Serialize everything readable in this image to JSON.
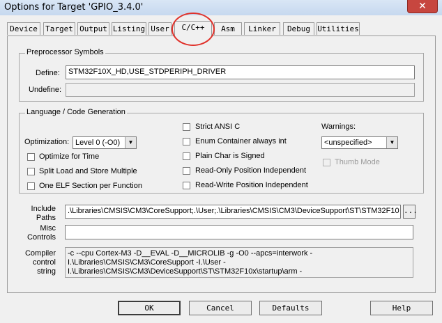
{
  "window": {
    "title": "Options for Target 'GPIO_3.4.0'",
    "close_label": "✕"
  },
  "tabs": [
    {
      "label": "Device"
    },
    {
      "label": "Target"
    },
    {
      "label": "Output"
    },
    {
      "label": "Listing"
    },
    {
      "label": "User"
    },
    {
      "label": "C/C++"
    },
    {
      "label": "Asm"
    },
    {
      "label": "Linker"
    },
    {
      "label": "Debug"
    },
    {
      "label": "Utilities"
    }
  ],
  "preprocessor": {
    "title": "Preprocessor Symbols",
    "define_label": "Define:",
    "define_value": "STM32F10X_HD,USE_STDPERIPH_DRIVER",
    "undefine_label": "Undefine:",
    "undefine_value": ""
  },
  "language": {
    "title": "Language / Code Generation",
    "optimization_label": "Optimization:",
    "optimization_value": "Level 0 (-O0)",
    "left_checks": [
      {
        "label": "Optimize for Time",
        "checked": false
      },
      {
        "label": "Split Load and Store Multiple",
        "checked": false
      },
      {
        "label": "One ELF Section per Function",
        "checked": false
      }
    ],
    "mid_checks": [
      {
        "label": "Strict ANSI C",
        "checked": false
      },
      {
        "label": "Enum Container always int",
        "checked": false
      },
      {
        "label": "Plain Char is Signed",
        "checked": false
      },
      {
        "label": "Read-Only Position Independent",
        "checked": false
      },
      {
        "label": "Read-Write Position Independent",
        "checked": false
      }
    ],
    "warnings_label": "Warnings:",
    "warnings_value": "<unspecified>",
    "thumb_mode_label": "Thumb Mode"
  },
  "include": {
    "label_line1": "Include",
    "label_line2": "Paths",
    "value": ".\\Libraries\\CMSIS\\CM3\\CoreSupport;.\\User;.\\Libraries\\CMSIS\\CM3\\DeviceSupport\\ST\\STM32F10",
    "browse_label": "..."
  },
  "misc": {
    "label_line1": "Misc",
    "label_line2": "Controls",
    "value": ""
  },
  "compiler": {
    "label_line1": "Compiler",
    "label_line2": "control",
    "label_line3": "string",
    "value": "-c --cpu Cortex-M3 -D__EVAL -D__MICROLIB -g -O0 --apcs=interwork -I.\\Libraries\\CMSIS\\CM3\\CoreSupport -I.\\User -I.\\Libraries\\CMSIS\\CM3\\DeviceSupport\\ST\\STM32F10x\\startup\\arm -"
  },
  "buttons": {
    "ok": "OK",
    "cancel": "Cancel",
    "defaults": "Defaults",
    "help": "Help"
  },
  "colors": {
    "annotation_circle": "#e0312a",
    "close_button": "#c7463f"
  }
}
